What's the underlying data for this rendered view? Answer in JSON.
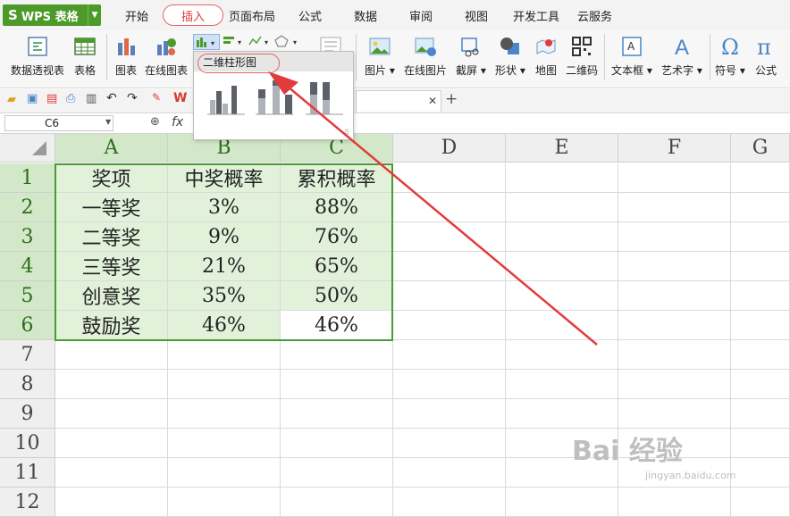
{
  "app": {
    "name": "WPS 表格"
  },
  "tabs": [
    "开始",
    "插入",
    "页面布局",
    "公式",
    "数据",
    "审阅",
    "视图",
    "开发工具",
    "云服务"
  ],
  "active_tab": "插入",
  "ribbon": {
    "left_buttons": [
      "数据透视表",
      "表格",
      "图表",
      "在线图表"
    ],
    "right_buttons": [
      "图片",
      "在线图片",
      "截屏",
      "形状",
      "地图",
      "二维码",
      "文本框",
      "艺术字",
      "符号",
      "公式"
    ],
    "chart_dropdown_header": "二维柱形图"
  },
  "formula_bar": {
    "cell_ref": "C6",
    "fx": "fx"
  },
  "spreadsheet": {
    "columns": [
      "A",
      "B",
      "C",
      "D",
      "E",
      "F",
      "G"
    ],
    "rows": [
      "1",
      "2",
      "3",
      "4",
      "5",
      "6",
      "7",
      "8",
      "9",
      "10",
      "11",
      "12"
    ],
    "data": [
      [
        "奖项",
        "中奖概率",
        "累积概率"
      ],
      [
        "一等奖",
        "3%",
        "88%"
      ],
      [
        "二等奖",
        "9%",
        "76%"
      ],
      [
        "三等奖",
        "21%",
        "65%"
      ],
      [
        "创意奖",
        "35%",
        "50%"
      ],
      [
        "鼓励奖",
        "46%",
        "46%"
      ]
    ]
  },
  "watermark": {
    "text": "Bai 经验",
    "url": "jingyan.baidu.com"
  },
  "colors": {
    "wps_green": "#4c9a2a",
    "selection_fill": "#e2f2da",
    "selection_border": "#4a9a35",
    "annotation_red": "#e23b3b"
  }
}
